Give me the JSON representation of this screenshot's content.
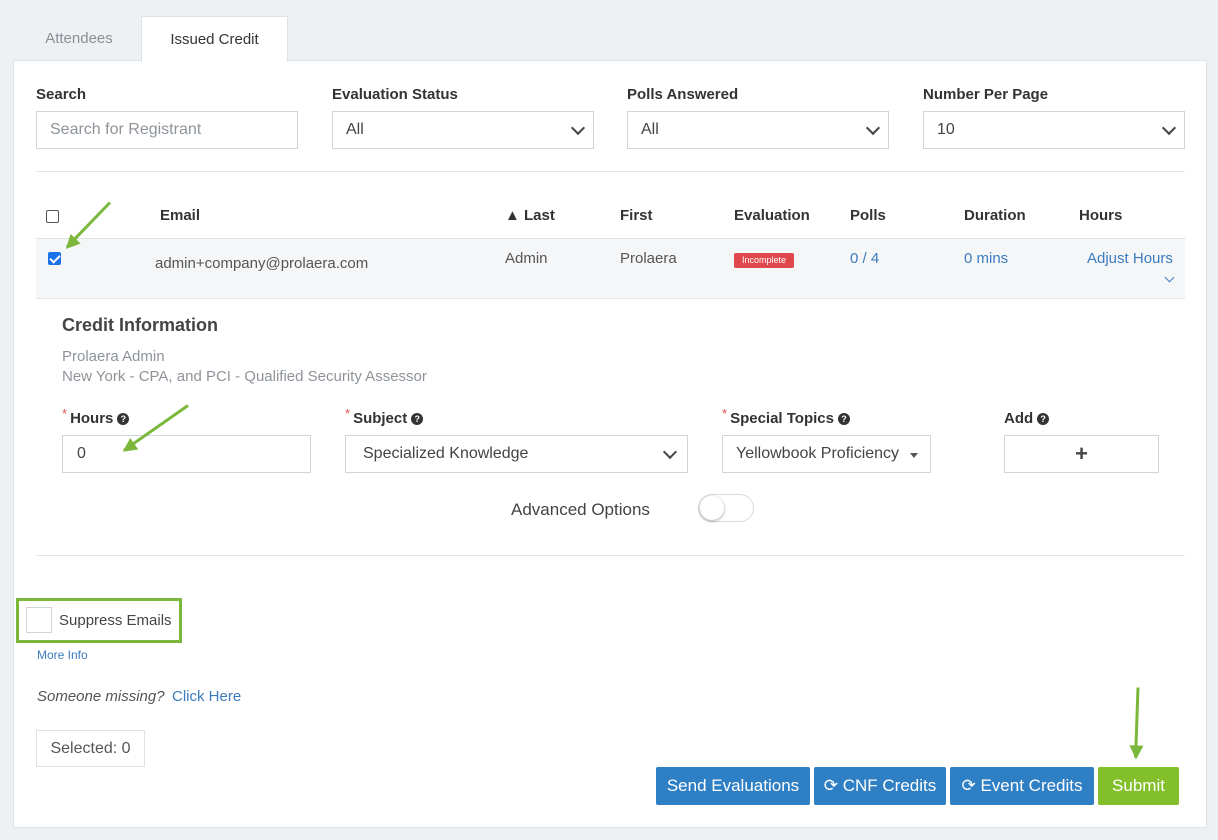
{
  "tabs": [
    {
      "label": "Attendees",
      "active": false
    },
    {
      "label": "Issued Credit",
      "active": true
    }
  ],
  "filters": {
    "search": {
      "label": "Search",
      "placeholder": "Search for Registrant",
      "value": ""
    },
    "evaluation_status": {
      "label": "Evaluation Status",
      "value": "All"
    },
    "polls_answered": {
      "label": "Polls Answered",
      "value": "All"
    },
    "number_per_page": {
      "label": "Number Per Page",
      "value": "10"
    }
  },
  "table": {
    "headers": {
      "email": "Email",
      "last": "▲ Last",
      "first": "First",
      "evaluation": "Evaluation",
      "polls": "Polls",
      "duration": "Duration",
      "hours": "Hours"
    },
    "rows": [
      {
        "checked": true,
        "email": "admin+company@prolaera.com",
        "last": "Admin",
        "first": "Prolaera",
        "evaluation": "Incomplete",
        "polls": "0 / 4",
        "duration": "0 mins",
        "hours_link": "Adjust Hours"
      }
    ]
  },
  "credit_info": {
    "title": "Credit Information",
    "name": "Prolaera Admin",
    "description": "New York - CPA, and PCI - Qualified Security Assessor",
    "hours": {
      "label": "Hours",
      "value": "0"
    },
    "subject": {
      "label": "Subject",
      "value": "Specialized Knowledge"
    },
    "special_topics": {
      "label": "Special Topics",
      "value": "Yellowbook Proficiency"
    },
    "add": {
      "label": "Add",
      "glyph": "+"
    },
    "advanced_options": {
      "label": "Advanced Options",
      "enabled": false
    }
  },
  "footer": {
    "suppress_emails": {
      "label": "Suppress Emails",
      "checked": false
    },
    "more_info": "More Info",
    "someone_missing": "Someone missing?",
    "click_here": "Click Here",
    "selected": "Selected: 0",
    "buttons": {
      "send_evaluations": "Send Evaluations",
      "cnf_credits": "CNF Credits",
      "event_credits": "Event Credits",
      "submit": "Submit"
    }
  },
  "colors": {
    "primary": "#2f7fc5",
    "success": "#82bf2a",
    "danger": "#e0474c",
    "annotation": "#7ab73a",
    "link": "#3b7bbf"
  },
  "icons": [
    "chevron-down-icon",
    "refresh-icon",
    "question-circle-icon",
    "plus-icon",
    "caret-down-icon"
  ]
}
